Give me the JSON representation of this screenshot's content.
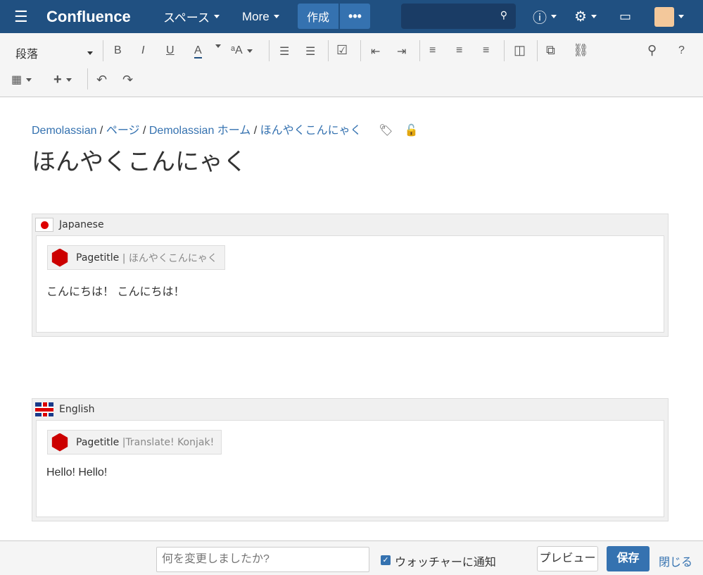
{
  "header": {
    "logo": "Confluence",
    "spaces": "スペース",
    "more": "More",
    "create": "作成",
    "more_actions": "•••",
    "search_placeholder": ""
  },
  "toolbar": {
    "paragraph": "段落",
    "bold": "B",
    "italic": "I",
    "underline": "U",
    "color": "A",
    "text_style": "ᵃA",
    "help": "?"
  },
  "breadcrumb": [
    "Demolassian",
    "ページ",
    "Demolassian ホーム",
    "ほんやくこんにゃく"
  ],
  "page_title": "ほんやくこんにゃく",
  "sections": [
    {
      "language": "Japanese",
      "pagetitle_label": "Pagetitle",
      "pagetitle_value": "| ほんやくこんにゃく",
      "text": "こんにちは！ こんにちは！"
    },
    {
      "language": "English",
      "pagetitle_label": "Pagetitle",
      "pagetitle_value": "|Translate!  Konjak!",
      "text": "Hello! Hello!"
    }
  ],
  "footer": {
    "comment_placeholder": "何を変更しましたか?",
    "notify": "ウォッチャーに通知",
    "preview": "プレビュー",
    "save": "保存",
    "close": "閉じる"
  },
  "colors": {
    "header": "#205081",
    "accent": "#3572b0"
  }
}
